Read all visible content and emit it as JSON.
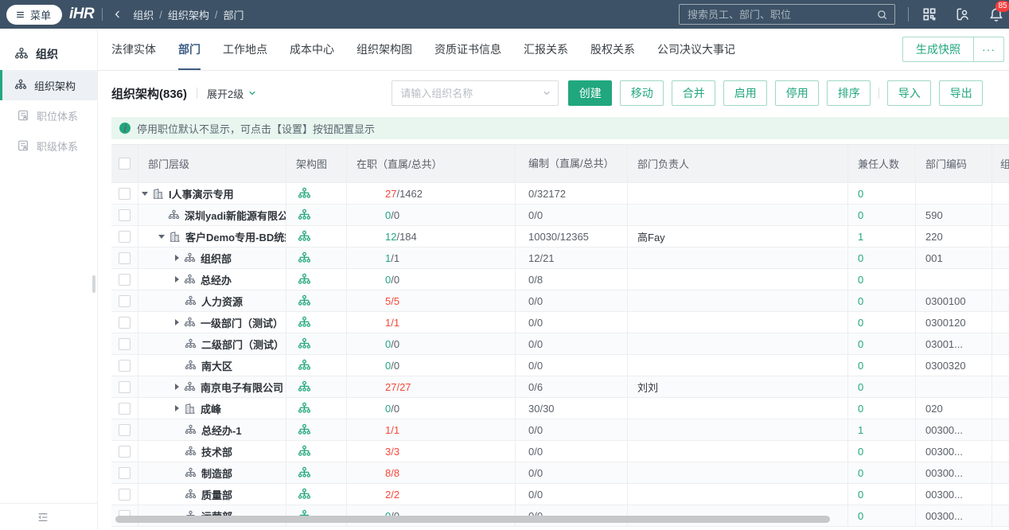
{
  "topbar": {
    "menu_label": "菜单",
    "logo": "iHR",
    "breadcrumb": [
      "组织",
      "组织架构",
      "部门"
    ],
    "search_placeholder": "搜索员工、部门、职位",
    "notification_badge": "85"
  },
  "sidebar": {
    "title": "组织",
    "items": [
      {
        "label": "组织架构",
        "active": true
      },
      {
        "label": "职位体系",
        "active": false
      },
      {
        "label": "职级体系",
        "active": false
      }
    ]
  },
  "tabs": {
    "items": [
      "法律实体",
      "部门",
      "工作地点",
      "成本中心",
      "组织架构图",
      "资质证书信息",
      "汇报关系",
      "股权关系",
      "公司决议大事记"
    ],
    "active": "部门",
    "snapshot_button": "生成快照",
    "more_button": "···"
  },
  "toolbar": {
    "title": "组织架构(836)",
    "expand_label": "展开2级",
    "search_placeholder": "请输入组织名称",
    "buttons": [
      "创建",
      "移动",
      "合并",
      "启用",
      "停用",
      "排序"
    ],
    "io_buttons": [
      "导入",
      "导出"
    ]
  },
  "banner": {
    "text": "停用职位默认不显示，可点击【设置】按钮配置显示"
  },
  "table": {
    "headers": [
      "部门层级",
      "架构图",
      "在职（直属/总共）",
      "编制（直属/总共）",
      "部门负责人",
      "兼任人数",
      "部门编码",
      "组"
    ],
    "rows": [
      {
        "level": 0,
        "arrow": "down",
        "icon": "building",
        "name": "I人事演示专用",
        "state": "mixed",
        "onduty_first": "27",
        "onduty_rest": "/1462",
        "headcount": "0/32172",
        "leader": "",
        "concurrent": "0",
        "code": ""
      },
      {
        "level": 1,
        "arrow": "",
        "icon": "org",
        "name": "深圳yadi新能源有限公司",
        "state": "normal",
        "onduty_first": "0",
        "onduty_rest": "/0",
        "headcount": "0/0",
        "leader": "",
        "concurrent": "0",
        "code": "590"
      },
      {
        "level": 1,
        "arrow": "down",
        "icon": "building",
        "name": "客户Demo专用-BD统筹",
        "state": "normal",
        "onduty_first": "12",
        "onduty_rest": "/184",
        "headcount": "10030/12365",
        "leader": "高Fay",
        "concurrent": "1",
        "code": "220"
      },
      {
        "level": 2,
        "arrow": "right",
        "icon": "org",
        "name": "组织部",
        "state": "normal",
        "onduty_first": "1",
        "onduty_rest": "/1",
        "headcount": "12/21",
        "leader": "",
        "concurrent": "0",
        "code": "001"
      },
      {
        "level": 2,
        "arrow": "right",
        "icon": "org",
        "name": "总经办",
        "state": "normal",
        "onduty_first": "0",
        "onduty_rest": "/0",
        "headcount": "0/8",
        "leader": "",
        "concurrent": "0",
        "code": ""
      },
      {
        "level": 2,
        "arrow": "",
        "icon": "org",
        "name": "人力资源",
        "state": "over",
        "onduty_first": "5",
        "onduty_rest": "/5",
        "headcount": "0/0",
        "leader": "",
        "concurrent": "0",
        "code": "0300100"
      },
      {
        "level": 2,
        "arrow": "right",
        "icon": "org",
        "name": "一级部门（测试）",
        "state": "over",
        "onduty_first": "1",
        "onduty_rest": "/1",
        "headcount": "0/0",
        "leader": "",
        "concurrent": "0",
        "code": "0300120"
      },
      {
        "level": 2,
        "arrow": "",
        "icon": "org",
        "name": "二级部门（测试）",
        "state": "normal",
        "onduty_first": "0",
        "onduty_rest": "/0",
        "headcount": "0/0",
        "leader": "",
        "concurrent": "0",
        "code": "03001..."
      },
      {
        "level": 2,
        "arrow": "",
        "icon": "org",
        "name": "南大区",
        "state": "normal",
        "onduty_first": "0",
        "onduty_rest": "/0",
        "headcount": "0/0",
        "leader": "",
        "concurrent": "0",
        "code": "0300320"
      },
      {
        "level": 2,
        "arrow": "right",
        "icon": "org",
        "name": "南京电子有限公司",
        "state": "over",
        "onduty_first": "27",
        "onduty_rest": "/27",
        "headcount": "0/6",
        "leader": "刘刘",
        "concurrent": "0",
        "code": ""
      },
      {
        "level": 2,
        "arrow": "right",
        "icon": "building",
        "name": "成峰",
        "state": "normal",
        "onduty_first": "0",
        "onduty_rest": "/0",
        "headcount": "30/30",
        "leader": "",
        "concurrent": "0",
        "code": "020"
      },
      {
        "level": 2,
        "arrow": "",
        "icon": "org",
        "name": "总经办-1",
        "state": "over",
        "onduty_first": "1",
        "onduty_rest": "/1",
        "headcount": "0/0",
        "leader": "",
        "concurrent": "1",
        "code": "00300..."
      },
      {
        "level": 2,
        "arrow": "",
        "icon": "org",
        "name": "技术部",
        "state": "over",
        "onduty_first": "3",
        "onduty_rest": "/3",
        "headcount": "0/0",
        "leader": "",
        "concurrent": "0",
        "code": "00300..."
      },
      {
        "level": 2,
        "arrow": "",
        "icon": "org",
        "name": "制造部",
        "state": "over",
        "onduty_first": "8",
        "onduty_rest": "/8",
        "headcount": "0/0",
        "leader": "",
        "concurrent": "0",
        "code": "00300..."
      },
      {
        "level": 2,
        "arrow": "",
        "icon": "org",
        "name": "质量部",
        "state": "over",
        "onduty_first": "2",
        "onduty_rest": "/2",
        "headcount": "0/0",
        "leader": "",
        "concurrent": "0",
        "code": "00300..."
      },
      {
        "level": 2,
        "arrow": "",
        "icon": "org",
        "name": "运营部",
        "state": "normal",
        "onduty_first": "0",
        "onduty_rest": "/0",
        "headcount": "0/0",
        "leader": "",
        "concurrent": "0",
        "code": "00300..."
      }
    ]
  },
  "colors": {
    "teal": "#21a77d",
    "red": "#f5483b",
    "rest_gray": "#5a6068",
    "topbar_bg": "#3d5266",
    "active_tab": "#3c5c84",
    "banner_bg": "#e8f6ef"
  }
}
